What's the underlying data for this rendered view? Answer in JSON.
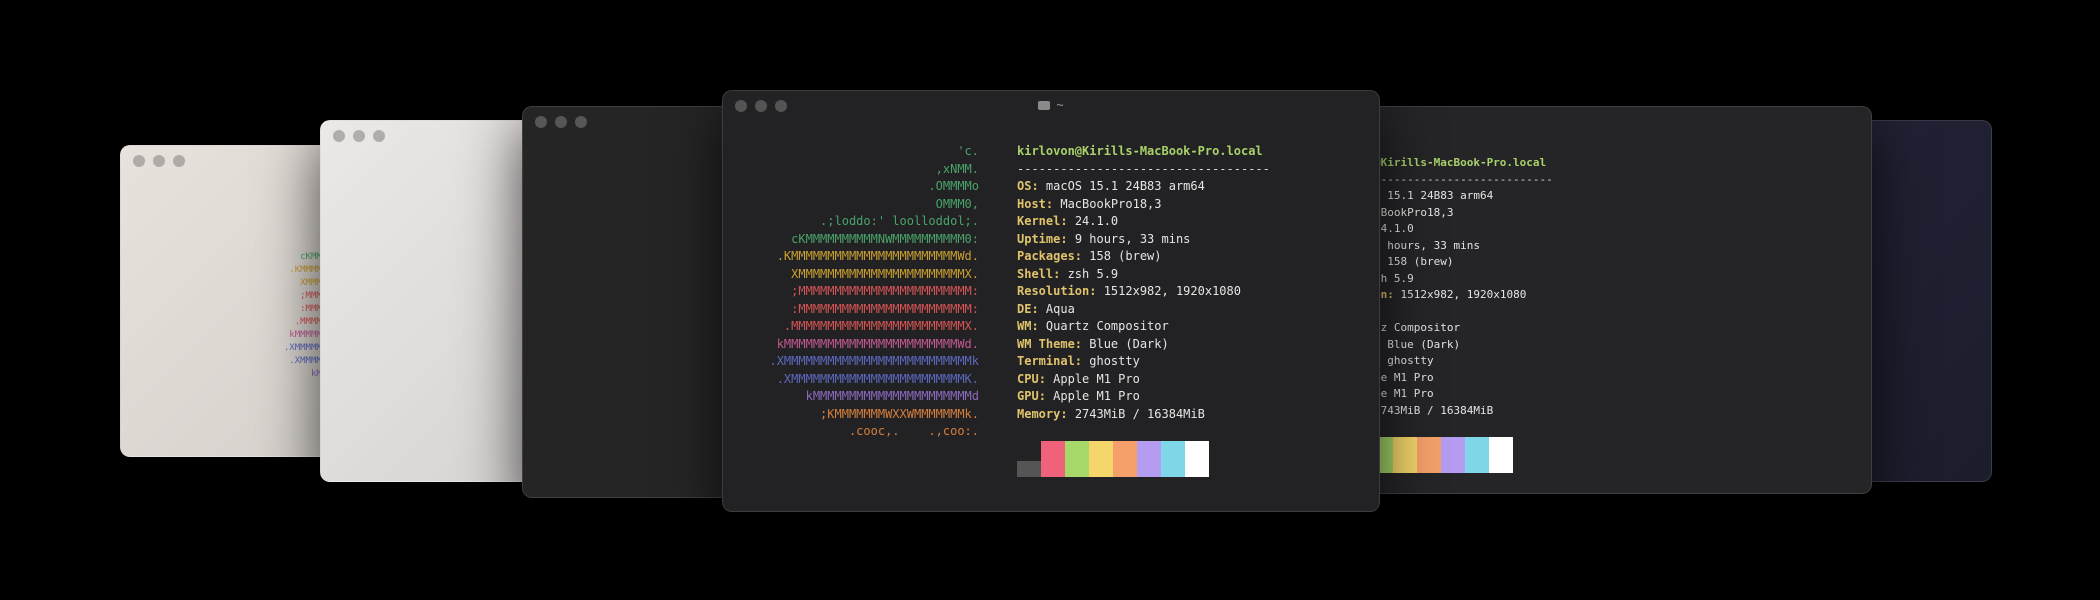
{
  "background": "#000000",
  "main_window": {
    "title": "~",
    "folder_icon": "folder-icon"
  },
  "neofetch": {
    "user_host": "kirlovon@Kirills-MacBook-Pro.local",
    "separator": "-----------------------------------",
    "fields": [
      {
        "label": "OS",
        "value": "macOS 15.1 24B83 arm64"
      },
      {
        "label": "Host",
        "value": "MacBookPro18,3"
      },
      {
        "label": "Kernel",
        "value": "24.1.0"
      },
      {
        "label": "Uptime",
        "value": "9 hours, 33 mins"
      },
      {
        "label": "Packages",
        "value": "158 (brew)"
      },
      {
        "label": "Shell",
        "value": "zsh 5.9"
      },
      {
        "label": "Resolution",
        "value": "1512x982, 1920x1080"
      },
      {
        "label": "DE",
        "value": "Aqua"
      },
      {
        "label": "WM",
        "value": "Quartz Compositor"
      },
      {
        "label": "WM Theme",
        "value": "Blue (Dark)"
      },
      {
        "label": "Terminal",
        "value": "ghostty"
      },
      {
        "label": "CPU",
        "value": "Apple M1 Pro"
      },
      {
        "label": "GPU",
        "value": "Apple M1 Pro"
      },
      {
        "label": "Memory",
        "value": "2743MiB / 16384MiB"
      }
    ],
    "palette": [
      "#555555",
      "#f0617a",
      "#a6d96a",
      "#f5d66a",
      "#f5a06a",
      "#b49cf0",
      "#7fd6e8",
      "#ffffff"
    ]
  },
  "ascii_art": [
    {
      "text": "'c.",
      "cls": "g"
    },
    {
      "text": ",xNMM.",
      "cls": "g"
    },
    {
      "text": ".OMMMMo",
      "cls": "g"
    },
    {
      "text": "OMMM0,",
      "cls": "g"
    },
    {
      "text": ".;loddo:' loolloddol;.",
      "cls": "g"
    },
    {
      "text": "cKMMMMMMMMMMNWMMMMMMMMMM0:",
      "cls": "g"
    },
    {
      "text": ".KMMMMMMMMMMMMMMMMMMMMMMMWd.",
      "cls": "y"
    },
    {
      "text": "XMMMMMMMMMMMMMMMMMMMMMMMX.",
      "cls": "y"
    },
    {
      "text": ";MMMMMMMMMMMMMMMMMMMMMMMM:",
      "cls": "r"
    },
    {
      "text": ":MMMMMMMMMMMMMMMMMMMMMMMM:",
      "cls": "r"
    },
    {
      "text": ".MMMMMMMMMMMMMMMMMMMMMMMMX.",
      "cls": "r"
    },
    {
      "text": "kMMMMMMMMMMMMMMMMMMMMMMMMWd.",
      "cls": "m"
    },
    {
      "text": ".XMMMMMMMMMMMMMMMMMMMMMMMMMMk",
      "cls": "b"
    },
    {
      "text": ".XMMMMMMMMMMMMMMMMMMMMMMMMK.",
      "cls": "b"
    },
    {
      "text": "kMMMMMMMMMMMMMMMMMMMMMMd",
      "cls": "pu"
    },
    {
      "text": ";KMMMMMMMWXXWMMMMMMMk.",
      "cls": "o"
    },
    {
      "text": ".cooc,.    .,coo:.",
      "cls": "o"
    }
  ]
}
